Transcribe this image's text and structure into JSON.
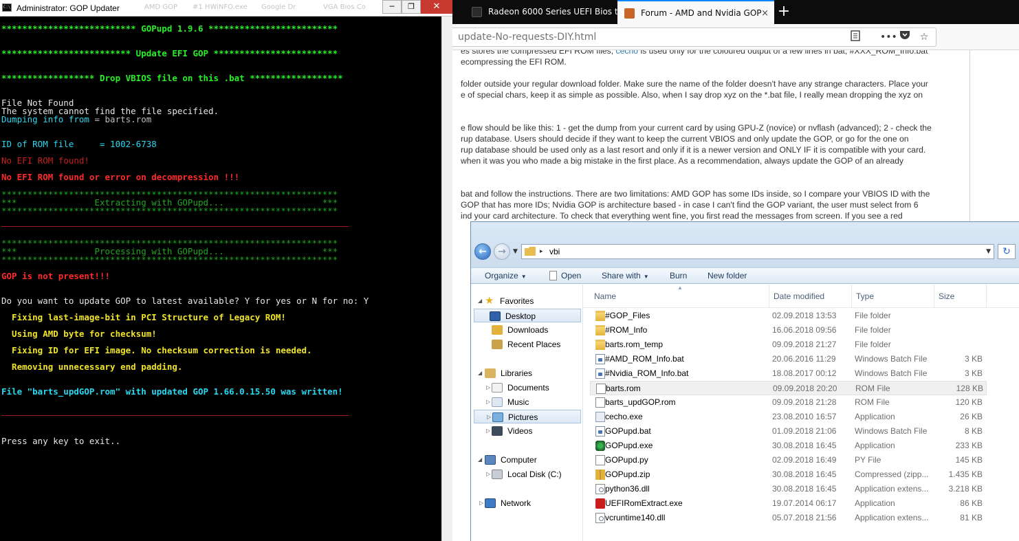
{
  "browser": {
    "tabs": [
      {
        "label": "Radeon 6000 Series UEFI Bios th",
        "icon_color": "#2b2b2b",
        "active": false
      },
      {
        "label": "Forum - AMD and Nvidia GOP",
        "icon_color": "#c86428",
        "active": true
      }
    ],
    "new_tab_glyph": "+",
    "tab_close_glyph": "×",
    "url": "update-No-requests-DIY.html",
    "nav_icons": [
      "reader-view-icon",
      "page-actions-icon",
      "pocket-icon",
      "bookmark-star-icon"
    ],
    "page_lines": [
      {
        "pre": "es stores the compressed EFI ROM files, ",
        "link": "cecho",
        "post": " is used only for the coloured output of a few lines in bat, #XXX_ROM_Info.bat"
      },
      {
        "pre": "ecompressing the EFI ROM.",
        "link": "",
        "post": ""
      },
      {
        "pre": "folder outside your regular download folder. Make sure the name of the folder doesn't have any strange characters. Place your",
        "link": "",
        "post": ""
      },
      {
        "pre": "e of special chars, keep it as simple as possible. Also, when I say drop xyz on the *.bat file, I really mean dropping the xyz on",
        "link": "",
        "post": ""
      },
      {
        "pre": "e flow should be like this: 1 - get the dump from your current card by using GPU-Z (novice) or nvflash (advanced); 2 - check the",
        "link": "",
        "post": ""
      },
      {
        "pre": "rup database. Users should decide if they want to keep the current VBIOS and only update the GOP, or go for the one on",
        "link": "",
        "post": ""
      },
      {
        "pre": "rup database should be used only as a last resort and only if it is a newer version and ONLY IF it is compatible with your card.",
        "link": "",
        "post": ""
      },
      {
        "pre": " when it was you who made a big mistake in the first place. As a recommendation, always update the GOP of an already",
        "link": "",
        "post": ""
      },
      {
        "pre": "bat and follow the instructions. There are two limitations: AMD GOP has some IDs inside, so I compare your VBIOS ID with the",
        "link": "",
        "post": ""
      },
      {
        "pre": " GOP that has more IDs; Nvidia GOP is architecture based - in case I can't find the GOP variant, the user must select from 6",
        "link": "",
        "post": ""
      },
      {
        "pre": "ind your card architecture. To check that everything went fine, you first read the messages from screen. If you see a red",
        "link": "",
        "post": ""
      }
    ]
  },
  "console": {
    "title": "Administrator:  GOP Updater",
    "icon_text": "C:\\",
    "ghost_tabs": [
      "AMD GOP",
      "#1 HWiNFO.exe",
      "Google Dr",
      "VGA Bios Co"
    ],
    "window_buttons": {
      "minimize": "─",
      "maximize": "❐",
      "close": "✕"
    },
    "lines": [
      {
        "text": "************************** GOPupd 1.9.6 *************************",
        "style": "green"
      },
      {
        "text": "************************* Update EFI GOP ************************",
        "style": "green"
      },
      {
        "text": "****************** Drop VBIOS file on this .bat ******************",
        "style": "green"
      },
      {
        "text": "File Not Found",
        "style": "white"
      },
      {
        "text": "The system cannot find the file specified.",
        "style": "white"
      },
      {
        "text": "Dumping info from",
        "style": "cyan",
        "suffix": " = barts.rom"
      },
      {
        "text": "ID of ROM file     = 1002-6738",
        "style": "cyan"
      },
      {
        "text": "No EFI ROM found!",
        "style": "dred"
      },
      {
        "text": "No EFI ROM found or error on decompression !!!",
        "style": "red"
      },
      {
        "text": "*****************************************************************",
        "style": "dgreen"
      },
      {
        "text": "***               Extracting with GOPupd...                   ***",
        "style": "dgreen"
      },
      {
        "text": "*****************************************************************",
        "style": "dgreen"
      },
      {
        "text": "*****************************************************************",
        "style": "dgreen"
      },
      {
        "text": "***               Processing with GOPupd...                   ***",
        "style": "dgreen"
      },
      {
        "text": "*****************************************************************",
        "style": "dgreen"
      },
      {
        "text": "GOP is not present!!!",
        "style": "red"
      },
      {
        "text": "Do you want to update GOP to latest available? Y for yes or N for no: Y",
        "style": "white"
      },
      {
        "text": "  Fixing last-image-bit in PCI Structure of Legacy ROM!",
        "style": "yellow"
      },
      {
        "text": "  Using AMD byte for checksum!",
        "style": "yellow"
      },
      {
        "text": "  Fixing ID for EFI image. No checksum correction is needed.",
        "style": "yellow"
      },
      {
        "text": "  Removing unnecessary end padding.",
        "style": "yellow"
      },
      {
        "text": "File \"barts_updGOP.rom\" with updated GOP 1.66.0.15.50 was written!",
        "style": "cyanb"
      },
      {
        "text": "Press any key to exit..",
        "style": "white"
      }
    ]
  },
  "explorer": {
    "path": "vbi",
    "toolbar": {
      "organize": "Organize",
      "open": "Open",
      "share_with": "Share with",
      "burn": "Burn",
      "new_folder": "New folder"
    },
    "nav": {
      "favorites": "Favorites",
      "desktop": "Desktop",
      "downloads": "Downloads",
      "recent_places": "Recent Places",
      "libraries": "Libraries",
      "documents": "Documents",
      "music": "Music",
      "pictures": "Pictures",
      "videos": "Videos",
      "computer": "Computer",
      "local_disk": "Local Disk (C:)",
      "network": "Network"
    },
    "columns": {
      "name": "Name",
      "date": "Date modified",
      "type": "Type",
      "size": "Size"
    },
    "files": [
      {
        "name": "#GOP_Files",
        "date": "02.09.2018 13:53",
        "type": "File folder",
        "size": "",
        "icon": "folder"
      },
      {
        "name": "#ROM_Info",
        "date": "16.06.2018 09:56",
        "type": "File folder",
        "size": "",
        "icon": "folder"
      },
      {
        "name": "barts.rom_temp",
        "date": "09.09.2018 21:27",
        "type": "File folder",
        "size": "",
        "icon": "folder"
      },
      {
        "name": "#AMD_ROM_Info.bat",
        "date": "20.06.2016 11:29",
        "type": "Windows Batch File",
        "size": "3 KB",
        "icon": "bat"
      },
      {
        "name": "#Nvidia_ROM_Info.bat",
        "date": "18.08.2017 00:12",
        "type": "Windows Batch File",
        "size": "3 KB",
        "icon": "bat"
      },
      {
        "name": "barts.rom",
        "date": "09.09.2018 20:20",
        "type": "ROM File",
        "size": "128 KB",
        "icon": "doc"
      },
      {
        "name": "barts_updGOP.rom",
        "date": "09.09.2018 21:28",
        "type": "ROM File",
        "size": "120 KB",
        "icon": "doc"
      },
      {
        "name": "cecho.exe",
        "date": "23.08.2010 16:57",
        "type": "Application",
        "size": "26 KB",
        "icon": "app"
      },
      {
        "name": "GOPupd.bat",
        "date": "01.09.2018 21:06",
        "type": "Windows Batch File",
        "size": "8 KB",
        "icon": "bat"
      },
      {
        "name": "GOPupd.exe",
        "date": "30.08.2018 16:45",
        "type": "Application",
        "size": "233 KB",
        "icon": "green"
      },
      {
        "name": "GOPupd.py",
        "date": "02.09.2018 16:49",
        "type": "PY File",
        "size": "145 KB",
        "icon": "doc"
      },
      {
        "name": "GOPupd.zip",
        "date": "30.08.2018 16:45",
        "type": "Compressed (zipp...",
        "size": "1.435 KB",
        "icon": "zip"
      },
      {
        "name": "python36.dll",
        "date": "30.08.2018 16:45",
        "type": "Application extens...",
        "size": "3.218 KB",
        "icon": "dll"
      },
      {
        "name": "UEFIRomExtract.exe",
        "date": "19.07.2014 06:17",
        "type": "Application",
        "size": "86 KB",
        "icon": "uefi"
      },
      {
        "name": "vcruntime140.dll",
        "date": "05.07.2018 21:56",
        "type": "Application extens...",
        "size": "81 KB",
        "icon": "dll"
      }
    ],
    "selected_file": "barts.rom"
  }
}
